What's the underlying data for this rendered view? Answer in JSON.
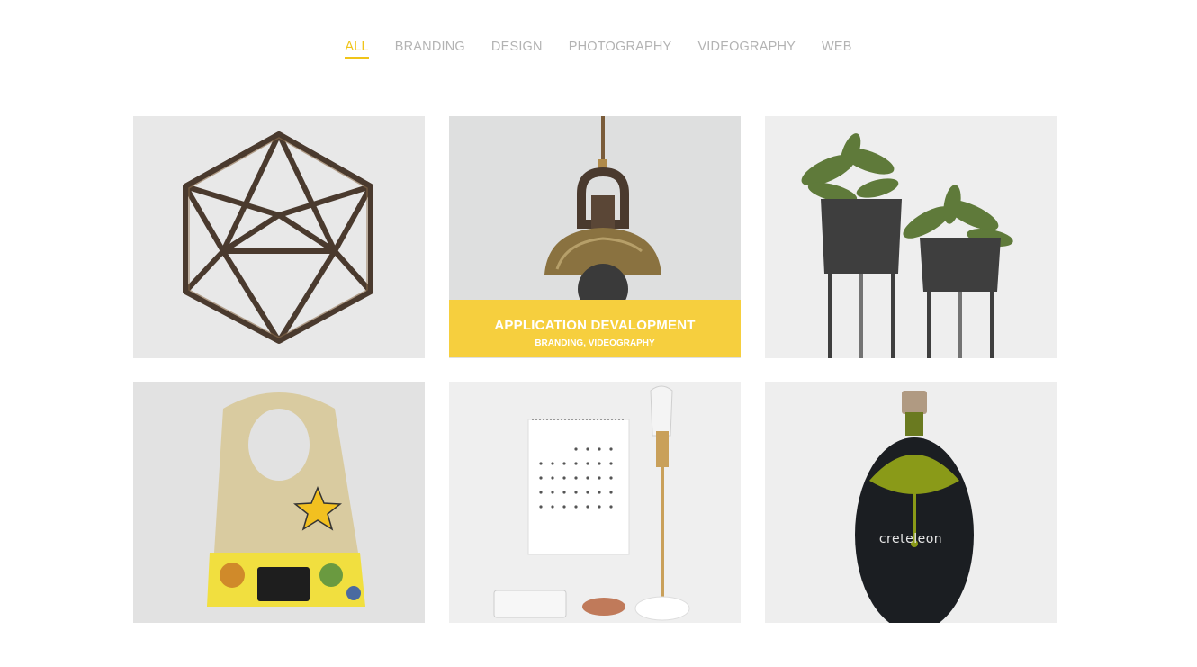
{
  "filters": {
    "items": [
      "ALL",
      "BRANDING",
      "DESIGN",
      "PHOTOGRAPHY",
      "VIDEOGRAPHY",
      "WEB"
    ],
    "active": "ALL",
    "active_color": "#f0c419",
    "inactive_color": "#b3b3b3"
  },
  "portfolio": {
    "items": [
      {
        "image": "geometric-sculpture-image"
      },
      {
        "image": "pendant-lamp-image",
        "title": "APPLICATION DEVALOPMENT",
        "categories": "BRANDING, VIDEOGRAPHY",
        "overlay_color": "#f6cf3e"
      },
      {
        "image": "potted-plants-image"
      },
      {
        "image": "baby-bib-image"
      },
      {
        "image": "calendar-lamp-image"
      },
      {
        "image": "olive-oil-bottle-image",
        "bottle_label": "creteleon"
      }
    ]
  }
}
